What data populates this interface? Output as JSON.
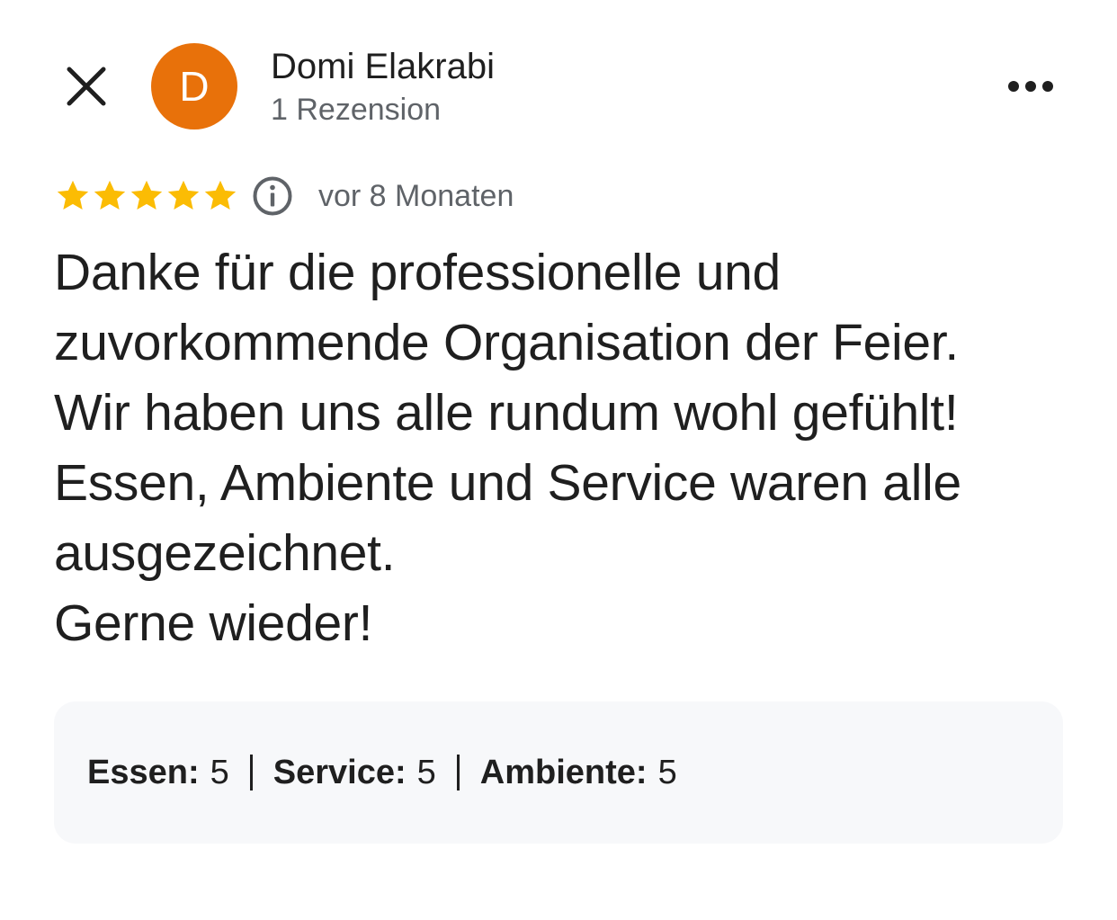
{
  "colors": {
    "avatar_bg": "#e8710a",
    "star": "#fbbc04",
    "text_primary": "#1f1f1f",
    "text_secondary": "#5f6368",
    "panel_bg": "#f7f8fa"
  },
  "header": {
    "close_icon": "close-icon",
    "avatar_letter": "D",
    "reviewer_name": "Domi Elakrabi",
    "review_count": "1 Rezension",
    "more_icon": "more-horizontal-icon"
  },
  "review": {
    "rating": 5,
    "max_rating": 5,
    "info_icon": "info-icon",
    "date": "vor 8 Monaten",
    "text": "Danke für die professionelle und\nzuvorkommende Organisation der Feier.\nWir haben uns alle rundum wohl gefühlt!\nEssen, Ambiente und Service waren alle\nausgezeichnet.\nGerne wieder!"
  },
  "sub_ratings": [
    {
      "label": "Essen:",
      "value": "5"
    },
    {
      "label": "Service:",
      "value": "5"
    },
    {
      "label": "Ambiente:",
      "value": "5"
    }
  ]
}
